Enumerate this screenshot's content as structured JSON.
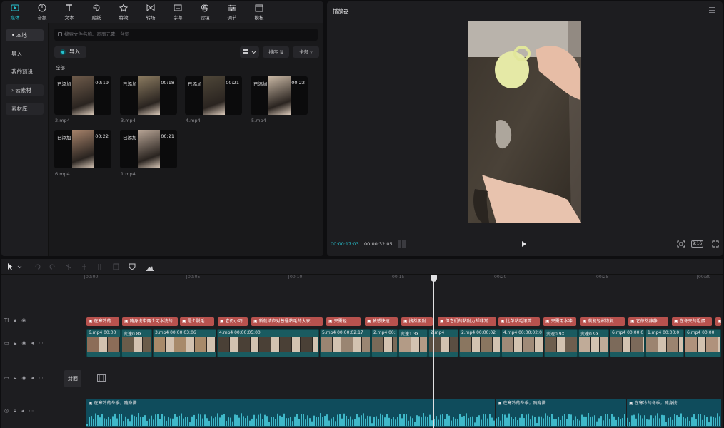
{
  "toolbar": {
    "tabs": [
      {
        "label": "媒体",
        "icon": "media-icon"
      },
      {
        "label": "音频",
        "icon": "audio-icon"
      },
      {
        "label": "文本",
        "icon": "text-icon"
      },
      {
        "label": "贴纸",
        "icon": "sticker-icon"
      },
      {
        "label": "特效",
        "icon": "effects-icon"
      },
      {
        "label": "转场",
        "icon": "transition-icon"
      },
      {
        "label": "字幕",
        "icon": "subtitle-icon"
      },
      {
        "label": "滤镜",
        "icon": "filter-icon"
      },
      {
        "label": "调节",
        "icon": "adjust-icon"
      },
      {
        "label": "模板",
        "icon": "template-icon"
      }
    ]
  },
  "sidebar": {
    "items": [
      {
        "label": "• 本地"
      },
      {
        "label": "导入"
      },
      {
        "label": "我的预设"
      },
      {
        "label": "› 云素材"
      },
      {
        "label": "素材库"
      }
    ]
  },
  "media": {
    "search_placeholder": "搜索文件名称、画面元素、台词",
    "import_label": "导入",
    "sort_label": "排序",
    "all_filter_label": "全部",
    "section_label": "全部",
    "added_label": "已添加",
    "items": [
      {
        "name": "2.mp4",
        "duration": "00:19"
      },
      {
        "name": "3.mp4",
        "duration": "00:18"
      },
      {
        "name": "4.mp4",
        "duration": "00:21"
      },
      {
        "name": "5.mp4",
        "duration": "00:22"
      },
      {
        "name": "6.mp4",
        "duration": "00:22"
      },
      {
        "name": "1.mp4",
        "duration": "00:21"
      }
    ]
  },
  "player": {
    "title": "播放器",
    "current_time": "00:00:17:03",
    "total_time": "00:00:32:05",
    "ratio_label": "9:16"
  },
  "timeline": {
    "ruler_ticks": [
      "00:00",
      "00:05",
      "00:10",
      "00:15",
      "00:20",
      "00:25",
      "00:30"
    ],
    "cover_label": "封面",
    "text_clips": [
      "在寒冷的",
      "随身携带两个可水洗的",
      "是个脱毛",
      "它仍小巧",
      "新就结应对普通粘毛的大衣",
      "只需轻",
      "触感快速",
      "搜然吸附",
      "但它们的粘附力却非常",
      "比单粘毛滚筒",
      "只需用水冲",
      "就能轻松恢复",
      "它依然静静",
      "在冬天的粗蛋",
      "冬"
    ],
    "video_clips": [
      {
        "label": "6.mp4  00:00"
      },
      {
        "label": "变速0.8X"
      },
      {
        "label": "3.mp4  00:00:03:06"
      },
      {
        "label": "4.mp4  00:00:05:00"
      },
      {
        "label": "5.mp4  00:00:02:17"
      },
      {
        "label": "2.mp4  00:"
      },
      {
        "label": "变速1.3X"
      },
      {
        "label": "2.mp4"
      },
      {
        "label": "2.mp4  00:00:02"
      },
      {
        "label": "4.mp4  00:00:02:0"
      },
      {
        "label": "变速0.9X"
      },
      {
        "label": "变速0.9X"
      },
      {
        "label": "6.mp4  00:00:0"
      },
      {
        "label": "1.mp4  00:00:0"
      },
      {
        "label": "6.mp4  00:00"
      }
    ],
    "audio_clips": [
      {
        "label": "在寒冷的冬季，随身携..."
      },
      {
        "label": "在寒冷的冬季，随身携..."
      },
      {
        "label": "在寒冷的冬季，随身携..."
      }
    ]
  },
  "colors": {
    "accent": "#27c2cf",
    "text_clip": "#b8524e",
    "video_clip": "#1a5b60",
    "audio_clip": "#0f4c5c"
  }
}
